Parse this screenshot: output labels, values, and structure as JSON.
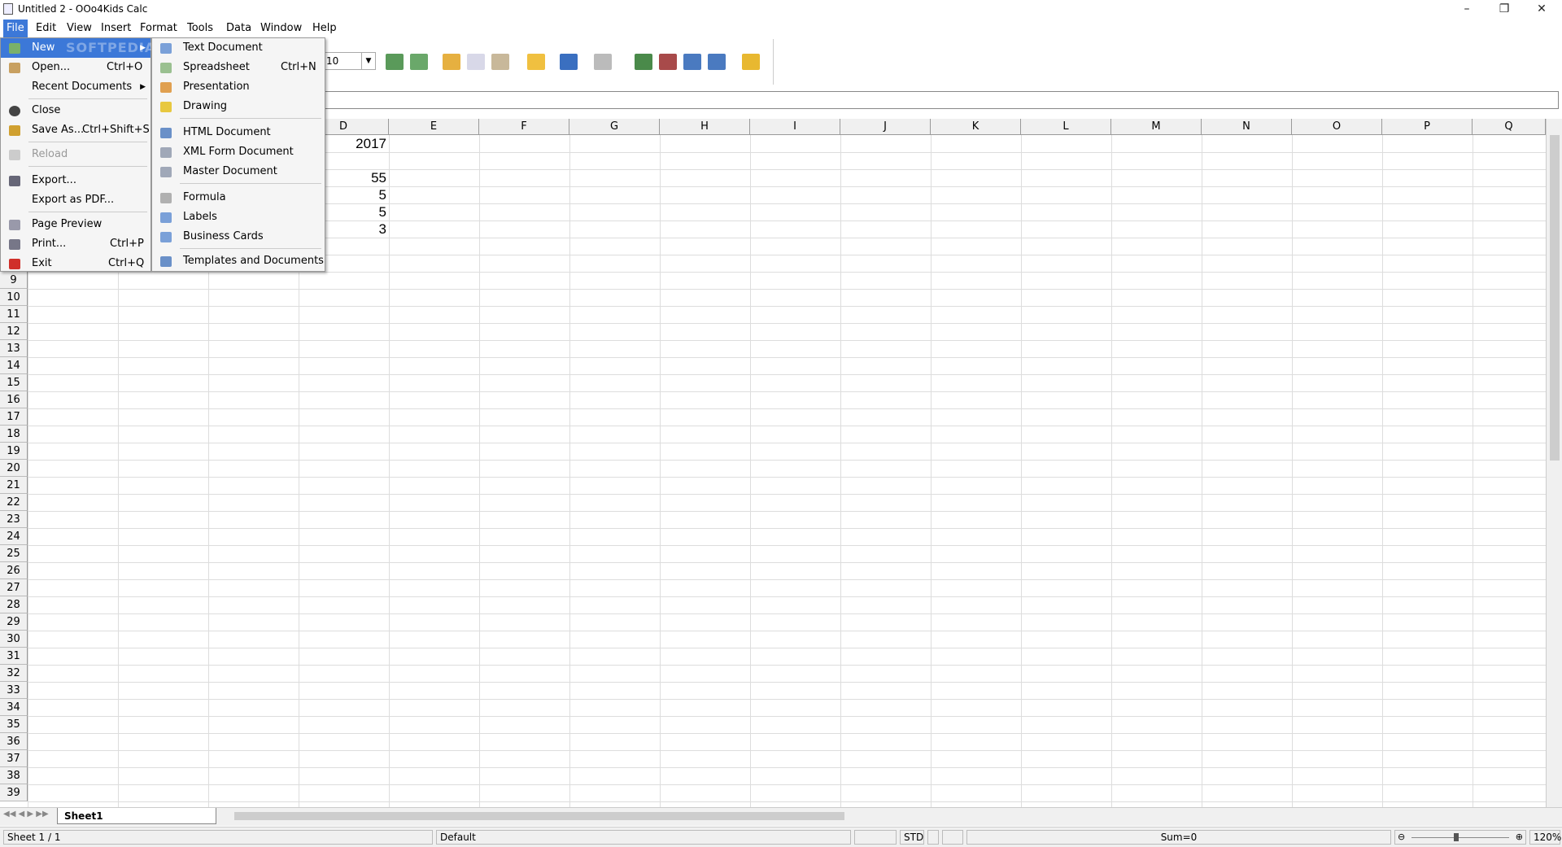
{
  "window": {
    "title": "Untitled 2 - OOo4Kids Calc",
    "controls": {
      "minimize": "–",
      "maximize": "❐",
      "close": "✕"
    }
  },
  "menubar": {
    "items": [
      {
        "label": "File"
      },
      {
        "label": "Edit"
      },
      {
        "label": "View"
      },
      {
        "label": "Insert"
      },
      {
        "label": "Format"
      },
      {
        "label": "Tools"
      },
      {
        "label": "Data"
      },
      {
        "label": "Window"
      },
      {
        "label": "Help"
      }
    ]
  },
  "toolbar": {
    "font_size": "10"
  },
  "file_menu": {
    "items": [
      {
        "label": "New",
        "shortcut": "",
        "has_submenu": true
      },
      {
        "label": "Open...",
        "shortcut": "Ctrl+O"
      },
      {
        "label": "Recent Documents",
        "shortcut": "",
        "has_submenu": true
      },
      {
        "label": "Close",
        "shortcut": ""
      },
      {
        "label": "Save As...",
        "shortcut": "Ctrl+Shift+S"
      },
      {
        "label": "Reload",
        "shortcut": ""
      },
      {
        "label": "Export...",
        "shortcut": ""
      },
      {
        "label": "Export as PDF...",
        "shortcut": ""
      },
      {
        "label": "Page Preview",
        "shortcut": ""
      },
      {
        "label": "Print...",
        "shortcut": "Ctrl+P"
      },
      {
        "label": "Exit",
        "shortcut": "Ctrl+Q"
      }
    ],
    "watermark": "SOFTPEDIA"
  },
  "new_submenu": {
    "items": [
      {
        "label": "Text Document",
        "shortcut": ""
      },
      {
        "label": "Spreadsheet",
        "shortcut": "Ctrl+N"
      },
      {
        "label": "Presentation",
        "shortcut": ""
      },
      {
        "label": "Drawing",
        "shortcut": ""
      },
      {
        "label": "HTML Document",
        "shortcut": ""
      },
      {
        "label": "XML Form Document",
        "shortcut": ""
      },
      {
        "label": "Master Document",
        "shortcut": ""
      },
      {
        "label": "Formula",
        "shortcut": ""
      },
      {
        "label": "Labels",
        "shortcut": ""
      },
      {
        "label": "Business Cards",
        "shortcut": ""
      },
      {
        "label": "Templates and Documents",
        "shortcut": ""
      }
    ]
  },
  "sheet": {
    "columns": [
      "D",
      "E",
      "F",
      "G",
      "H",
      "I",
      "J",
      "K",
      "L",
      "M",
      "N",
      "O",
      "P",
      "Q"
    ],
    "rows": [
      "9",
      "10",
      "11",
      "12",
      "13",
      "14",
      "15",
      "16",
      "17",
      "18",
      "19",
      "20",
      "21",
      "22",
      "23",
      "24",
      "25",
      "26",
      "27",
      "28",
      "29",
      "30",
      "31",
      "32",
      "33",
      "34",
      "35",
      "36",
      "37",
      "38",
      "39"
    ],
    "cells": {
      "d1": "2017",
      "d3": "55",
      "d4": "5",
      "d5": "5",
      "d6": "3"
    }
  },
  "tabs": {
    "sheet1": "Sheet1"
  },
  "statusbar": {
    "sheet": "Sheet 1 / 1",
    "style": "Default",
    "mode": "STD",
    "sum": "Sum=0",
    "zoom": "120%"
  }
}
